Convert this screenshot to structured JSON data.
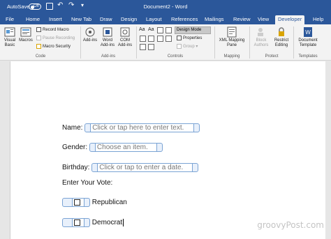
{
  "titlebar": {
    "autosave_label": "AutoSave",
    "autosave_state": "Off",
    "document_title": "Document2 - Word",
    "icons": [
      "save-icon",
      "undo-icon",
      "redo-icon",
      "customize-icon"
    ]
  },
  "tabs": [
    "File",
    "Home",
    "Insert",
    "New Tab",
    "Draw",
    "Design",
    "Layout",
    "References",
    "Mailings",
    "Review",
    "View",
    "Developer",
    "Help"
  ],
  "active_tab": "Developer",
  "ribbon": {
    "code": {
      "label": "Code",
      "visual_basic": "Visual Basic",
      "macros": "Macros",
      "record_macro": "Record Macro",
      "pause_recording": "Pause Recording",
      "macro_security": "Macro Security"
    },
    "addins": {
      "label": "Add-ins",
      "addins": "Add-ins",
      "word_addins": "Word Add-ins",
      "com_addins": "COM Add-ins"
    },
    "controls": {
      "label": "Controls",
      "design_mode": "Design Mode",
      "properties": "Properties",
      "group": "Group"
    },
    "mapping": {
      "label": "Mapping",
      "xml_mapping_pane": "XML Mapping Pane"
    },
    "protect": {
      "label": "Protect",
      "block_authors": "Block Authors",
      "restrict_editing": "Restrict Editing"
    },
    "templates": {
      "label": "Templates",
      "document_template": "Document Template"
    }
  },
  "document": {
    "name_label": "Name:",
    "name_placeholder": "Click or tap here to enter text.",
    "gender_label": "Gender:",
    "gender_placeholder": "Choose an item.",
    "birthday_label": "Birthday:",
    "birthday_placeholder": "Click or tap to enter a date.",
    "vote_label": "Enter Your Vote:",
    "option1": "Republican",
    "option2": "Democrat"
  },
  "watermark": "groovyPost.com",
  "colors": {
    "word_blue": "#2b579a",
    "control_border": "#7aa3d4"
  }
}
